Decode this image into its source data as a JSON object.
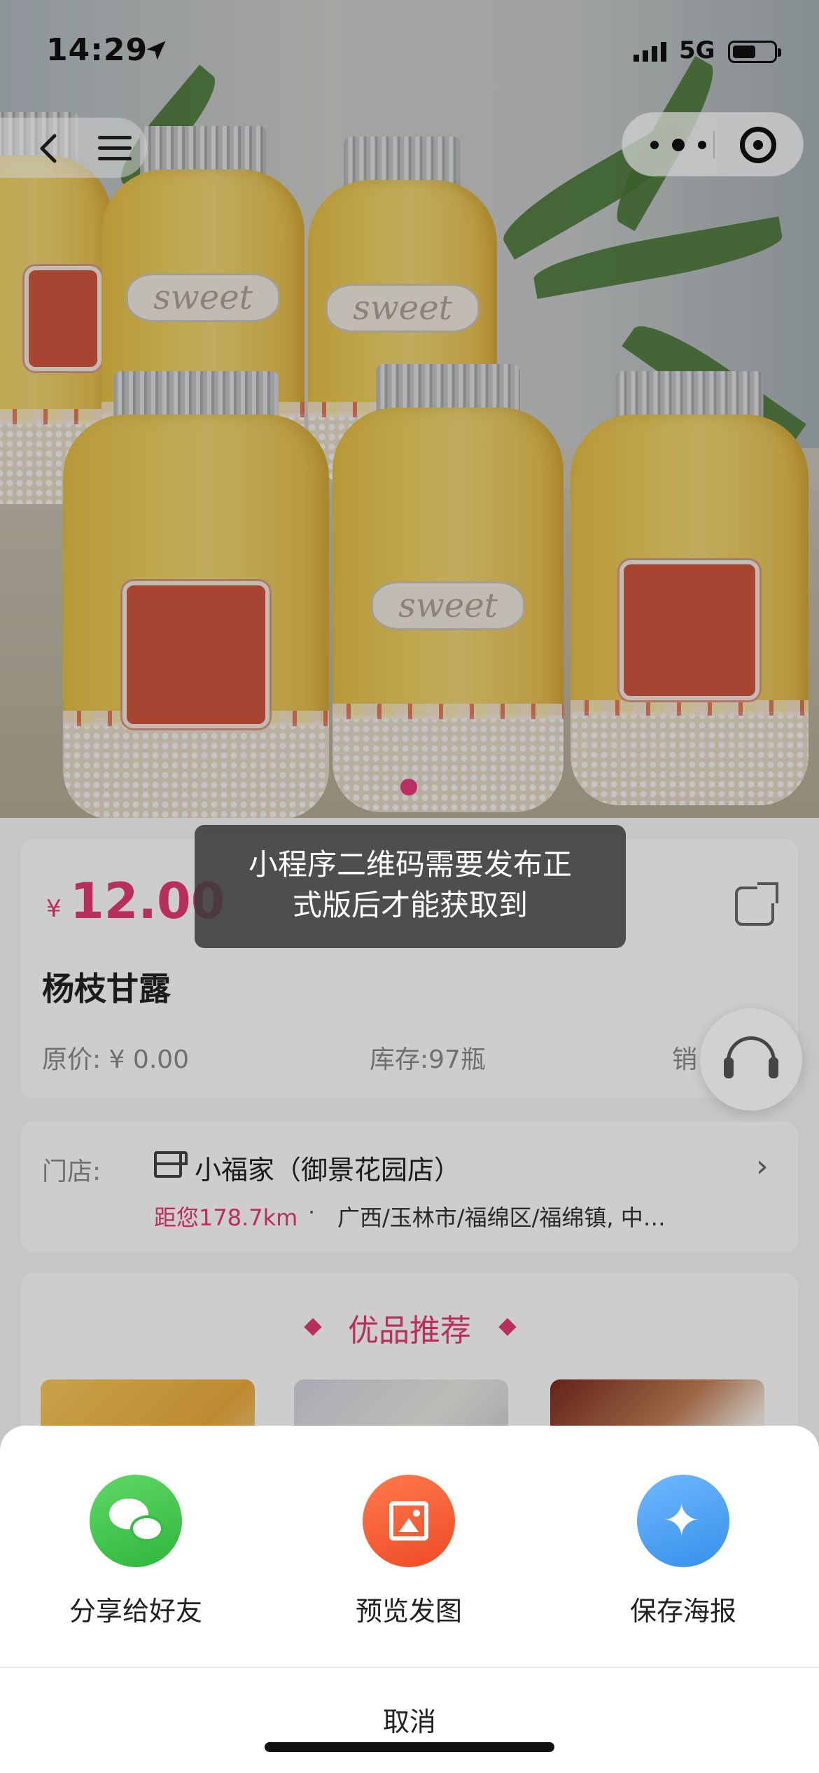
{
  "status_bar": {
    "time": "14:29",
    "network": "5G",
    "location_icon": "location-arrow-icon",
    "signal_icon": "signal-bars-icon",
    "battery_icon": "battery-icon"
  },
  "nav": {
    "back_icon": "chevron-left-icon",
    "menu_icon": "hamburger-menu-icon",
    "more_icon": "more-dots-icon",
    "close_icon": "miniprogram-close-icon"
  },
  "product": {
    "currency_symbol": "¥",
    "price": "12.00",
    "name": "杨枝甘露",
    "original_price": "原价: ¥ 0.00",
    "stock": "库存:97瓶",
    "sales": "销",
    "carousel_active_index": 0,
    "image_label": "sweet"
  },
  "toast": {
    "line1": "小程序二维码需要发布正",
    "line2": "式版后才能获取到"
  },
  "store": {
    "label": "门店:",
    "name": "小福家（御景花园店）",
    "distance": "距您178.7km",
    "separator": "·",
    "address": "广西/玉林市/福绵区/福绵镇, 中…"
  },
  "recommend": {
    "title": "优品推荐"
  },
  "share_sheet": {
    "options": [
      {
        "label": "分享给好友",
        "icon": "wechat-icon",
        "color": "#38bd44"
      },
      {
        "label": "预览发图",
        "icon": "image-icon",
        "color": "#f05a30"
      },
      {
        "label": "保存海报",
        "icon": "star-sparkle-icon",
        "color": "#479ff0"
      }
    ],
    "cancel_label": "取消"
  },
  "colors": {
    "accent": "#e23a6f"
  }
}
